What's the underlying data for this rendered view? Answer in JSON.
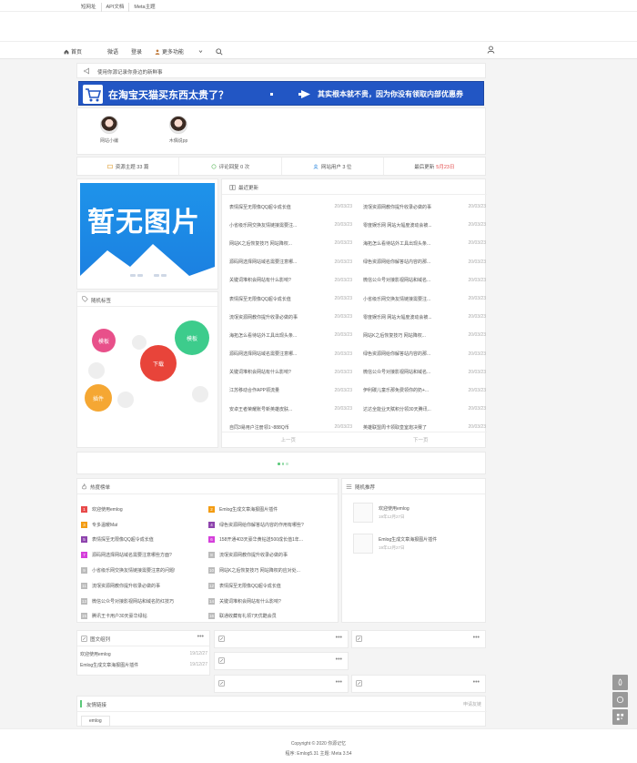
{
  "topbar": {
    "links": [
      "短网址",
      "API文档",
      "Meta主题"
    ]
  },
  "nav": {
    "items": [
      "首页",
      "微语",
      "登录",
      "更多功能"
    ]
  },
  "notice": {
    "text": "使用你源记录你身边的新鲜事"
  },
  "banner": {
    "text1": "在淘宝天猫买东西太贵了？",
    "text2": "其实根本就不贵，因为你没有领取内部优惠券"
  },
  "authors": [
    {
      "name": "网站小编"
    },
    {
      "name": "木偶说pp"
    }
  ],
  "stats": {
    "posts": "资源主题 33 篇",
    "comments": "评论回复 0 次",
    "users": "网站用户 3 位",
    "update_label": "最后更新",
    "update_value": "5月23日"
  },
  "slide": {
    "placeholder": "暂无图片"
  },
  "tags": {
    "title": "随机标签",
    "bubbles": [
      "模板",
      "模板",
      "下载",
      "插件"
    ]
  },
  "latest": {
    "title": "最近更新",
    "left": [
      {
        "t": "表情探至无限像QQ超令成长值",
        "d": "20/03/23"
      },
      {
        "t": "小省级乐网交换友情链接需要注...",
        "d": "20/03/23"
      },
      {
        "t": "网站K之后恢复技巧 网站降权...",
        "d": "20/03/23"
      },
      {
        "t": "源码网选择网站域名需要注意哪...",
        "d": "20/03/23"
      },
      {
        "t": "关键词堆积会网站有什么影响?",
        "d": "20/03/23"
      },
      {
        "t": "表情探至无限像QQ超令成长值",
        "d": "20/03/23"
      },
      {
        "t": "流氓资源网教你提升收录必做的事",
        "d": "20/03/23"
      },
      {
        "t": "海拓怎么看待站外工具出现头条...",
        "d": "20/03/23"
      },
      {
        "t": "源码网选择网站域名需要注意哪...",
        "d": "20/03/23"
      },
      {
        "t": "关键词堆积会网站有什么影响?",
        "d": "20/03/23"
      },
      {
        "t": "江苏移动合作APP领流量",
        "d": "20/03/23"
      },
      {
        "t": "安卓王者荣耀账号新英雄皮肤...",
        "d": "20/03/23"
      },
      {
        "t": "自同3易用户注册领1~888Q币",
        "d": "20/03/23"
      }
    ],
    "right": [
      {
        "t": "流氓资源网教你提升收录必做的事",
        "d": "20/03/23"
      },
      {
        "t": "零度娱乐网 网站大幅度波动会被...",
        "d": "20/03/23"
      },
      {
        "t": "海拓怎么看待站外工具出现头条...",
        "d": "20/03/23"
      },
      {
        "t": "绿色资源网给你解答站内容的那...",
        "d": "20/03/23"
      },
      {
        "t": "微信公众号对接影视网站和域名...",
        "d": "20/03/23"
      },
      {
        "t": "小省级乐网交换友情链接需要注...",
        "d": "20/03/23"
      },
      {
        "t": "零度娱乐网 网站大幅度波动会被...",
        "d": "20/03/23"
      },
      {
        "t": "网站K之后恢复技巧 网站降权...",
        "d": "20/03/23"
      },
      {
        "t": "绿色资源网给你解答站内容的那...",
        "d": "20/03/23"
      },
      {
        "t": "微信公众号对接影视网站和域名...",
        "d": "20/03/23"
      },
      {
        "t": "伊利碳儿童乐那免费领你的奶+...",
        "d": "20/03/23"
      },
      {
        "t": "达达全能业天赋积分领30天腾讯...",
        "d": "20/03/23"
      },
      {
        "t": "英雄联盟周卡领取皇室炮决赛了",
        "d": "20/03/23"
      }
    ],
    "prev": "上一页",
    "next": "下一页"
  },
  "hot": {
    "title": "热度榜单",
    "colors": [
      "#e84a4a",
      "#f39c12",
      "#8e44ad",
      "#d53fdb",
      "#bbbbbb"
    ],
    "left": [
      "欢迎使用emlog",
      "专多温暖Mat",
      "表情探至无限像QQ超令成长值",
      "源码网选择网站域名需要注意哪些方面?",
      "小省级乐网交换友情链接需要注意的问题!",
      "流氓资源网教你提升收录必做的事",
      "微信公众号对接影视网站和域名防红技巧",
      "腾讯王卡用户30天豪华绿钻"
    ],
    "right": [
      "Emlog生成文章海报图片插件",
      "绿色资源网给你解答站内容的作用有哪些?",
      "158开通403天豪华黄钻送500成长值1年...",
      "流氓资源网教你提升收录必做的事",
      "网站K之后恢复技巧 网站降权的应对处...",
      "表情探至无限像QQ超令成长值",
      "关键词堆积会网站有什么影响?",
      "联通收藏有礼领7天优酷会员"
    ]
  },
  "rec": {
    "title": "随机推荐",
    "items": [
      {
        "t": "欢迎使用emlog",
        "d": "19年12月27日"
      },
      {
        "t": "Emlog生成文章海报图片插件",
        "d": "19年12月27日"
      }
    ]
  },
  "catbig": {
    "title": "图文组列",
    "rows": [
      {
        "t": "欢迎使用emlog",
        "d": "19/12/27"
      },
      {
        "t": "Emlog生成文章海报图片插件",
        "d": "19/12/27"
      }
    ]
  },
  "cats_more": "•••",
  "links": {
    "title": "友情链接",
    "apply": "申请友链",
    "items": [
      "emlog"
    ]
  },
  "footer": {
    "line1": "Copyright © 2020  你源记忆",
    "line2": "程序: Emlog5.31    主题: Meta 3.54"
  }
}
